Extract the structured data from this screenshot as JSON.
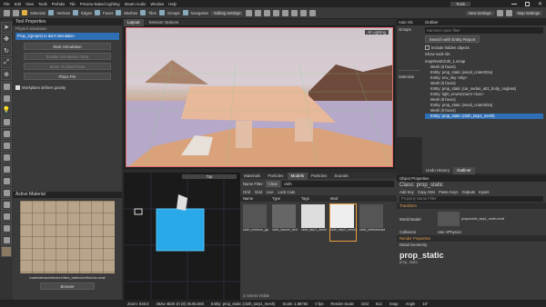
{
  "menu": {
    "items": [
      "File",
      "Edit",
      "View",
      "Tools",
      "Prefabs",
      "Tile",
      "Preview Baked Lighting",
      "Steam Audio",
      "Window",
      "Help"
    ],
    "tools_label": "Tools"
  },
  "toolbar": {
    "tabs": [
      "Selection",
      "Vertices",
      "Edges",
      "Faces",
      "Meshes",
      "Tiles",
      "Groups",
      "Navigation",
      "Editing Settings"
    ],
    "new_settings": "New Settings",
    "map_settings": "Map Settings"
  },
  "left_panel": {
    "title": "Tool Properties",
    "section": "Physics simulation",
    "selection_text": "Prop_1(prop/s) to don't simulation",
    "buttons": [
      "Start Simulation",
      "Enable Simulation Step",
      "Move To Bind Pose",
      "Place Pin"
    ],
    "checkbox_label": "Workplane defines gravity"
  },
  "material_panel": {
    "title": "Active Material",
    "path": "materials/architecture/tiles_bathroomfloor1a.vmat",
    "browse": "Browse"
  },
  "viewport": {
    "tabs": [
      "Layout",
      "Session Options"
    ],
    "lighting": "All Lighting",
    "view_label": "Top"
  },
  "asset_browser": {
    "tabs": [
      "Materials",
      "Particles",
      "Models",
      "Particles",
      "Sounds"
    ],
    "name_filter_label": "Name Filter:",
    "name_filter_value": "cloth",
    "clear": "Clear",
    "filter_options": [
      "Grid",
      "Grid",
      "Live",
      "Lock Cam"
    ],
    "columns": [
      "Name",
      "Type",
      "Tags",
      "Mod"
    ],
    "assets": [
      {
        "name": "cloth_medium_garage_rectum_clothed"
      },
      {
        "name": "cloth_banner_textured"
      },
      {
        "name": "cloth_tarp1_mesh"
      },
      {
        "name": "cloth_tarp2_mesh"
      },
      {
        "name": "cloth_beltedresizable"
      }
    ],
    "status": "3 Assets Visible"
  },
  "outliner": {
    "tabs": [
      "Outliner"
    ],
    "window_title": "Outliner",
    "filter_placeholder": "Hammer name filter",
    "search_btn": "Search with Entity Report",
    "include_hidden": "Include hidden objects",
    "show_node": "Show node ids",
    "tree": [
      "maps\\test\\cloth_1.vmap",
      "Mesh (8 faces)",
      "Entity: prop_static (wood_crate002a)",
      "Entity: env_sky <sky>",
      "Mesh (6 faces)",
      "Entity: prop_static (car_sedan_a01_body_noglass)",
      "Entity: light_environment <sun>",
      "Mesh (8 faces)",
      "Entity: prop_static (wood_crate002a)",
      "Mesh (8 faces)",
      "Entity: prop_static (cloth_tarp1_mesh)"
    ],
    "bottom_tabs": [
      "Undo History",
      "Outliner"
    ]
  },
  "side_tree": {
    "title": "Auto Vis",
    "group": "Groups",
    "selection": "Selection"
  },
  "object_properties": {
    "title": "Object Properties",
    "class_label": "Class:",
    "class_value": "prop_static",
    "actions": [
      "Add Key",
      "Copy Attrs",
      "Paste Keys",
      "Outputs",
      "Inputs"
    ],
    "property_filter": "Property Name Filter",
    "section_transform": "Transform",
    "world_model_label": "World Model",
    "world_model_value": "props/cloth_tarp1_mesh.vmdl",
    "collisions_label": "Collisions",
    "collisions_value": "Use VPhysics",
    "section_render": "Render Properties",
    "detail_geometry": "Detail Geometry",
    "big_title": "prop_static",
    "sub_title": "prop_static"
  },
  "statusbar": {
    "zoom": "Zoom: 640.0",
    "coords": "462w 4826 1h (8) 36.65.550",
    "entity": "Entity: prop_static (cloth_tarp1_mesh)",
    "scale": "Scale: 1.88784",
    "fps": "0 fps",
    "render": "Render Scale",
    "grid": "Grid",
    "grid_val": "512",
    "snap": "Snap",
    "angle_label": "Angle",
    "angle_val": "15°"
  }
}
